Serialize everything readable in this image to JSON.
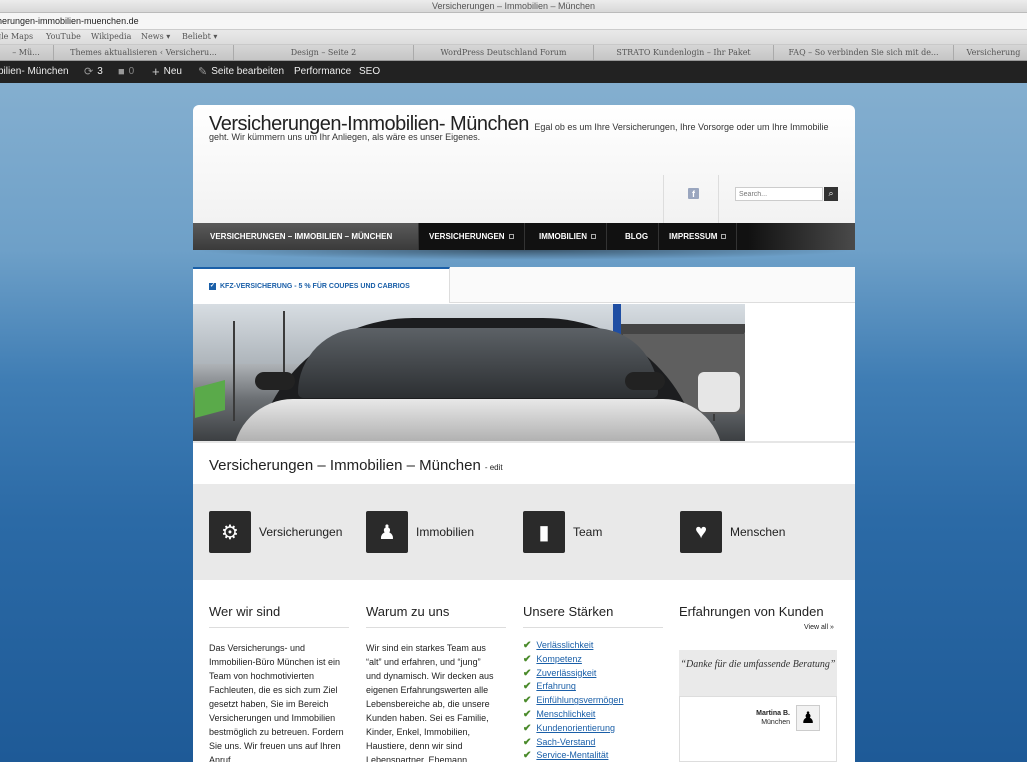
{
  "browser": {
    "window_title": "Versicherungen – Immobilien – München",
    "url": "herungen-immobilien-muenchen.de",
    "bookmarks": [
      "gle Maps",
      "YouTube",
      "Wikipedia",
      "News ▾",
      "Beliebt ▾"
    ],
    "tabs": [
      "– Mü...",
      "Themes aktualisieren ‹ Versicheru...",
      "Design – Seite 2",
      "WordPress Deutschland Forum",
      "STRATO Kundenlogin – Ihr Paket",
      "FAQ – So verbinden Sie sich mit de...",
      "Versicherung"
    ]
  },
  "admin_bar": {
    "site_name": "bilien- München",
    "updates_count": "3",
    "comments_count": "0",
    "new_label": "Neu",
    "edit_page_label": "Seite bearbeiten",
    "performance_label": "Performance",
    "seo_label": "SEO"
  },
  "header": {
    "site_title": "Versicherungen-Immobilien- München",
    "tagline": "Egal ob es um Ihre Versicherungen, Ihre Vorsorge oder um Ihre Immobilie geht. Wir kümmern uns um Ihr Anliegen, als wäre es unser Eigenes.",
    "facebook_label": "f",
    "search_placeholder": "Search..."
  },
  "nav": {
    "items": [
      {
        "label": "VERSICHERUNGEN – IMMOBILIEN – MÜNCHEN"
      },
      {
        "label": "VERSICHERUNGEN"
      },
      {
        "label": "IMMOBILIEN"
      },
      {
        "label": "BLOG"
      },
      {
        "label": "IMPRESSUM"
      }
    ]
  },
  "slider": {
    "tab_label": "KFZ-VERSICHERUNG - 5 % FÜR COUPES UND CABRIOS"
  },
  "page": {
    "title": "Versicherungen – Immobilien – München",
    "edit_label": "- edit"
  },
  "features": [
    {
      "label": "Versicherungen",
      "icon": "gears-icon"
    },
    {
      "label": "Immobilien",
      "icon": "person-icon"
    },
    {
      "label": "Team",
      "icon": "chart-icon"
    },
    {
      "label": "Menschen",
      "icon": "heart-icon"
    }
  ],
  "columns": {
    "who": {
      "title": "Wer wir sind",
      "text": "Das Versicherungs- und Immobilien-Büro München ist ein Team von hochmotivierten Fachleuten, die es sich zum Ziel gesetzt haben, Sie im Bereich Versicherungen und Immobilien bestmöglich zu betreuen. Fordern Sie uns. Wir freuen uns auf Ihren Anruf."
    },
    "why": {
      "title": "Warum zu uns",
      "text": "Wir sind ein starkes Team aus “alt” und erfahren, und “jung” und dynamisch. Wir decken aus eigenen Erfahrungswerten alle Lebensbereiche ab, die unsere Kunden haben. Sei es Familie, Kinder, Enkel, Immobilien, Haustiere, denn wir sind Lebenspartner, Ehemann,"
    },
    "strengths": {
      "title": "Unsere Stärken",
      "items": [
        "Verlässlichkeit",
        "Kompetenz",
        "Zuverlässigkeit",
        "Erfahrung",
        "Einfühlungsvermögen",
        "Menschlichkeit",
        "Kundenorientierung",
        "Sach-Verstand",
        "Service-Mentalität"
      ]
    },
    "reviews": {
      "title": "Erfahrungen von Kunden",
      "view_all": "View all »",
      "quote": "“Danke für die umfassende Beratung”",
      "author": "Martina B.",
      "location": "München"
    }
  }
}
